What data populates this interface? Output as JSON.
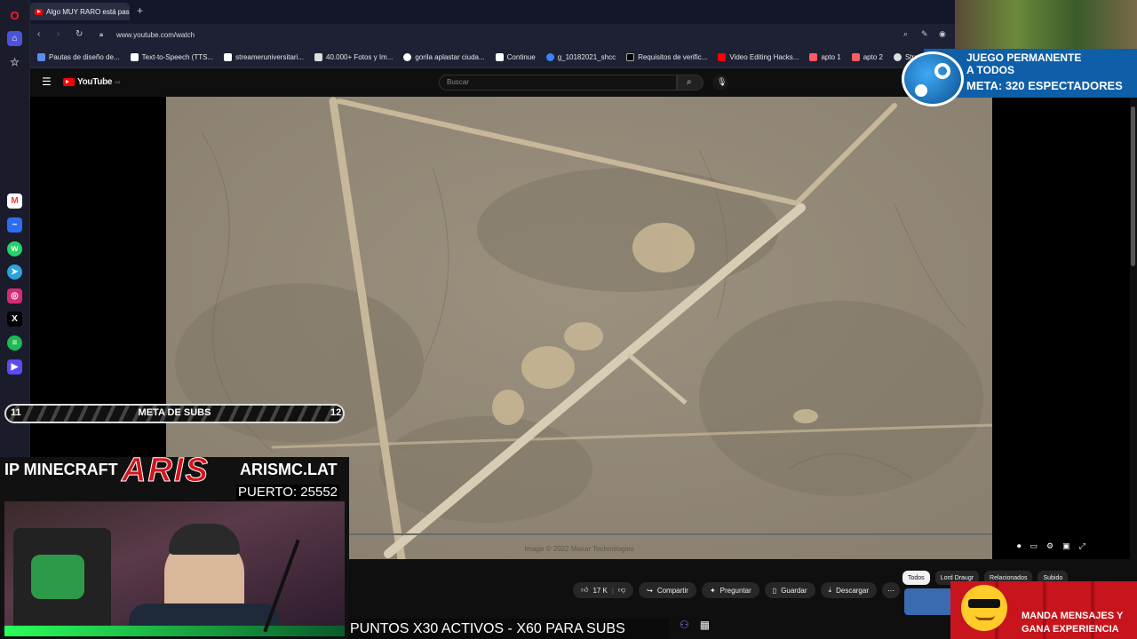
{
  "browser": {
    "tab_title": "Algo MUY RARO está pas",
    "url": "www.youtube.com/watch",
    "bookmarks": [
      "Pautas de diseño de...",
      "Text-to-Speech (TTS...",
      "streameruniversitari...",
      "40.000+ Fotos y Im...",
      "gorila aplastar ciuda...",
      "Continue",
      "g_10182021_shcc",
      "Requisitos de verific...",
      "Video Editing Hacks...",
      "apto 1",
      "apto 2",
      "StreamEl"
    ]
  },
  "youtube": {
    "logo_text": "YouTube",
    "logo_country": "CO",
    "search_placeholder": "Buscar",
    "map_credit": "Image © 2022 Maxar Technologies",
    "actions": {
      "likes": "17 K",
      "share": "Compartir",
      "ask": "Preguntar",
      "save": "Guardar",
      "download": "Descargar"
    },
    "chips": [
      "Todos",
      "Lord Draugr",
      "Relacionados",
      "Subido"
    ]
  },
  "stream_overlay": {
    "steam_line1": "JUEGO PERMANENTE",
    "steam_line2": "A TODOS",
    "steam_goal_label": "META:",
    "steam_goal_value": "320 ESPECTADORES",
    "subs_start": "11",
    "subs_label": "META DE SUBS",
    "subs_end": "12",
    "ip_label": "IP MINECRAFT",
    "brand": "ARIS",
    "server": "ARISMC.LAT",
    "port": "PUERTO: 25552",
    "ticker": "PUNTOS X30 ACTIVOS - X60 PARA SUBS",
    "promo_line1": "MANDA MENSAJES Y",
    "promo_line2": "GANA EXPERIENCIA"
  },
  "colors": {
    "youtube_red": "#ff0000",
    "steam_banner": "#0e5fa8",
    "aris_red": "#d4141a",
    "promo_red": "#c8141c"
  }
}
